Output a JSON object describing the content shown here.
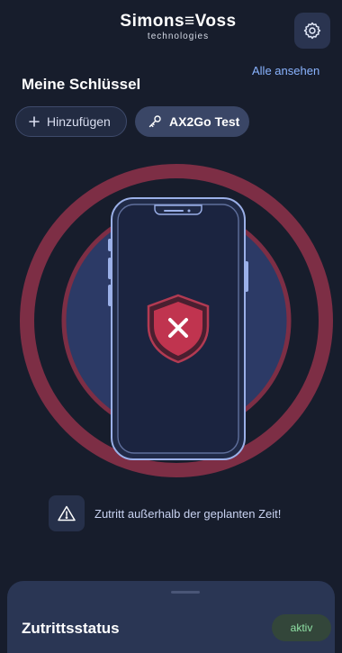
{
  "header": {
    "brand": "Simons≡Voss",
    "brand_sub": "technologies",
    "settings_icon": "gear-icon"
  },
  "keys": {
    "title": "Meine Schlüssel",
    "see_all": "Alle ansehen",
    "add_label": "Hinzufügen",
    "key_label": "AX2Go Test"
  },
  "status_visual": {
    "state": "denied",
    "icon": "shield-x-icon",
    "ring_color": "#7d2e45",
    "circle_color": "#2c3a66"
  },
  "warning": {
    "icon": "warning-triangle-icon",
    "text": "Zutritt außerhalb der geplanten Zeit!"
  },
  "access_status": {
    "title": "Zutrittsstatus",
    "badge": "aktiv",
    "badge_color": "#8fe0a4"
  }
}
